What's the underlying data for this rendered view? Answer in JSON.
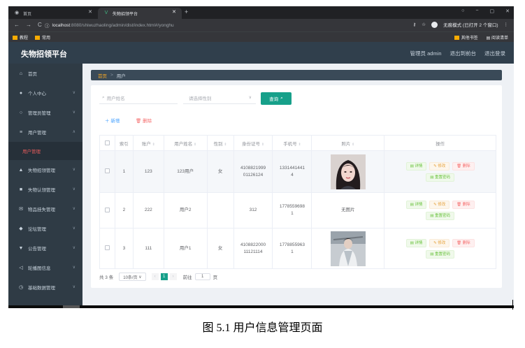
{
  "browser": {
    "tabs": [
      {
        "label": "首页",
        "icon": "globe-icon"
      },
      {
        "label": "失物招领平台",
        "icon": "vue-icon"
      }
    ],
    "new_tab": "+",
    "window_buttons": [
      "○",
      "−",
      "▢",
      "✕"
    ],
    "nav": [
      "←",
      "→",
      "C"
    ],
    "url_host": "localhost",
    "url_rest": ":8080/shiwuzhaoling/admin/dist/index.html#/yonghu",
    "incognito_label": "无痕模式 (已打开 2 个窗口)",
    "bookmarks": [
      "教程",
      "常用"
    ],
    "bookmarks_right": [
      "其他书签",
      "阅读清单"
    ]
  },
  "header": {
    "title": "失物招领平台",
    "links": [
      "管理员 admin",
      "退出到前台",
      "退出登录"
    ]
  },
  "sidebar": {
    "items": [
      {
        "label": "首页",
        "icon": "home-icon",
        "glyph": "⌂"
      },
      {
        "label": "个人中心",
        "icon": "person-icon",
        "glyph": "●"
      },
      {
        "label": "管理员管理",
        "icon": "circle-icon",
        "glyph": "○"
      },
      {
        "label": "用户管理",
        "icon": "list-icon",
        "glyph": "≡"
      },
      {
        "label": "失物招领管理",
        "icon": "bank-icon",
        "glyph": "▲"
      },
      {
        "label": "失物认领管理",
        "icon": "building-icon",
        "glyph": "■"
      },
      {
        "label": "物品挂失管理",
        "icon": "mail-icon",
        "glyph": "✉"
      },
      {
        "label": "论坛管理",
        "icon": "location-icon",
        "glyph": "◆"
      },
      {
        "label": "公告管理",
        "icon": "medal-icon",
        "glyph": "▼"
      },
      {
        "label": "轮播图信息",
        "icon": "send-icon",
        "glyph": "◁"
      },
      {
        "label": "基础数据管理",
        "icon": "clock-icon",
        "glyph": "◷"
      }
    ],
    "active_sub": "用户管理"
  },
  "breadcrumb": {
    "home": "首页",
    "sep": ">",
    "current": "用户"
  },
  "search": {
    "name_placeholder": "用户姓名",
    "gender_placeholder": "请选择性别",
    "query_label": "查询"
  },
  "toolbar": {
    "add_label": "新增",
    "delete_label": "删除"
  },
  "table": {
    "headers": [
      "索引",
      "账户",
      "用户姓名",
      "性别",
      "身份证号",
      "手机号",
      "照片",
      "操作"
    ],
    "rows": [
      {
        "index": "1",
        "account": "123",
        "name": "123用户",
        "gender": "女",
        "id_card_1": "4108821999",
        "id_card_2": "01126124",
        "phone_1": "1331441441",
        "phone_2": "4",
        "photo": "portrait-1"
      },
      {
        "index": "2",
        "account": "222",
        "name": "用户2",
        "gender": "",
        "id_card_1": "312",
        "id_card_2": "",
        "phone_1": "1778559698",
        "phone_2": "1",
        "photo_text": "无图片"
      },
      {
        "index": "3",
        "account": "111",
        "name": "用户1",
        "gender": "女",
        "id_card_1": "4108822000",
        "id_card_2": "11121114",
        "phone_1": "1778855963",
        "phone_2": "1",
        "photo": "portrait-2"
      }
    ],
    "actions": {
      "detail": "详情",
      "edit": "修改",
      "delete": "删除",
      "reset": "重置密码"
    }
  },
  "pagination": {
    "total": "共 3 条",
    "page_size": "10条/页",
    "current_page": "1",
    "goto_label": "前往",
    "goto_value": "1",
    "page_suffix": "页"
  },
  "caption": "图 5.1 用户信息管理页面",
  "colors": {
    "accent": "#17a08a",
    "header": "#303f4c",
    "sidebar": "#2f3b45",
    "danger": "#f56c6c"
  }
}
